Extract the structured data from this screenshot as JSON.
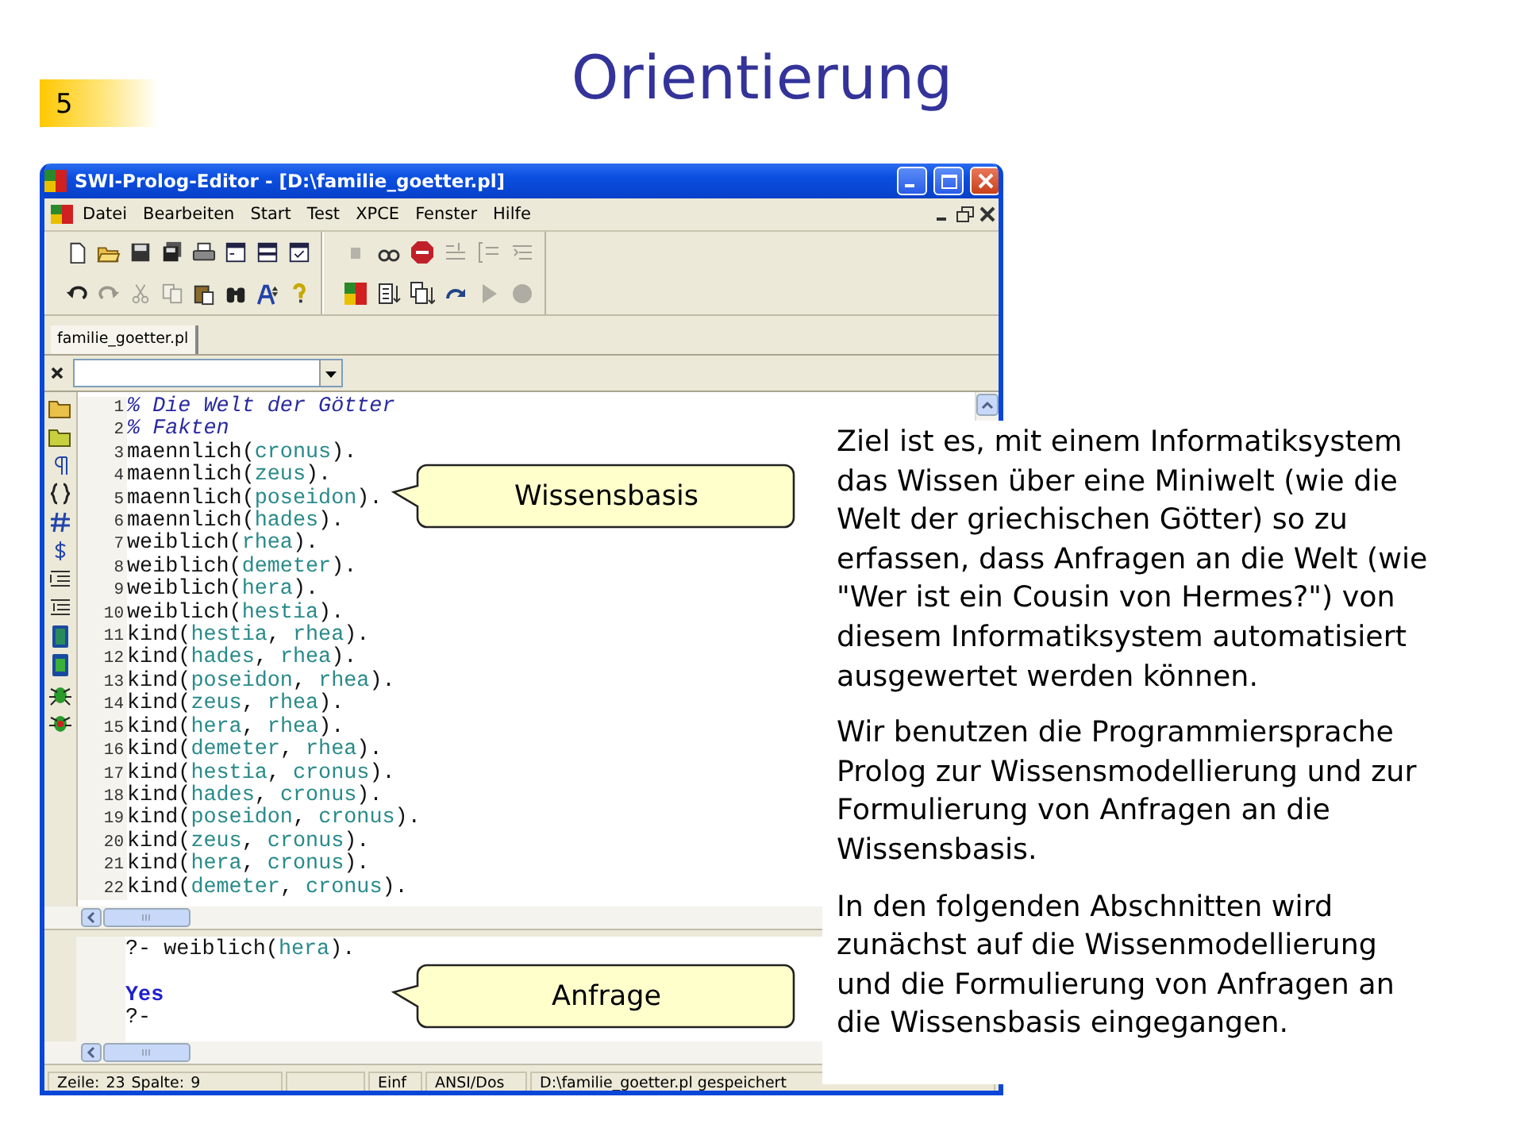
{
  "slide": {
    "number": "5",
    "title": "Orientierung"
  },
  "window": {
    "title": "SWI-Prolog-Editor - [D:\\familie_goetter.pl]",
    "menu": [
      "Datei",
      "Bearbeiten",
      "Start",
      "Test",
      "XPCE",
      "Fenster",
      "Hilfe"
    ],
    "toolbar_rows": [
      {
        "groups": [
          {
            "buttons": [
              {
                "kind": "new",
                "disabled": false
              },
              {
                "kind": "open",
                "disabled": false
              },
              {
                "kind": "save",
                "disabled": false
              },
              {
                "kind": "saveall",
                "disabled": false
              },
              {
                "kind": "print",
                "disabled": false
              },
              {
                "kind": "console",
                "disabled": false
              },
              {
                "kind": "split",
                "disabled": false
              },
              {
                "kind": "check",
                "disabled": false
              }
            ]
          },
          {
            "buttons": [
              {
                "kind": "square",
                "disabled": true
              },
              {
                "kind": "glasses",
                "disabled": false
              },
              {
                "kind": "stop",
                "disabled": false
              },
              {
                "kind": "stepin",
                "disabled": true
              },
              {
                "kind": "stepover",
                "disabled": true
              },
              {
                "kind": "stepout",
                "disabled": true
              }
            ]
          }
        ]
      },
      {
        "groups": [
          {
            "buttons": [
              {
                "kind": "undo",
                "disabled": false
              },
              {
                "kind": "redo",
                "disabled": true
              },
              {
                "kind": "cut",
                "disabled": true
              },
              {
                "kind": "copy",
                "disabled": true
              },
              {
                "kind": "paste",
                "disabled": false
              },
              {
                "kind": "find",
                "disabled": false
              },
              {
                "kind": "font",
                "disabled": false
              },
              {
                "kind": "help",
                "disabled": false
              }
            ]
          },
          {
            "buttons": [
              {
                "kind": "logo",
                "disabled": false
              },
              {
                "kind": "consult",
                "disabled": false
              },
              {
                "kind": "consultall",
                "disabled": false
              },
              {
                "kind": "rerun",
                "disabled": false
              },
              {
                "kind": "play",
                "disabled": true
              },
              {
                "kind": "record",
                "disabled": true
              }
            ]
          }
        ]
      }
    ],
    "tabs": [
      {
        "label": "familie_goetter.pl",
        "selected": true
      }
    ],
    "editor_lines": [
      {
        "number": "1",
        "tokens": [
          {
            "text": "% Die Welt der Götter",
            "kind": "comment"
          }
        ]
      },
      {
        "number": "2",
        "tokens": [
          {
            "text": "% Fakten",
            "kind": "comment"
          }
        ]
      },
      {
        "number": "3",
        "tokens": [
          {
            "text": "maennlich(",
            "kind": "plain"
          },
          {
            "text": "cronus",
            "kind": "atom"
          },
          {
            "text": ").",
            "kind": "plain"
          }
        ]
      },
      {
        "number": "4",
        "tokens": [
          {
            "text": "maennlich(",
            "kind": "plain"
          },
          {
            "text": "zeus",
            "kind": "atom"
          },
          {
            "text": ").",
            "kind": "plain"
          }
        ]
      },
      {
        "number": "5",
        "tokens": [
          {
            "text": "maennlich(",
            "kind": "plain"
          },
          {
            "text": "poseidon",
            "kind": "atom"
          },
          {
            "text": ").",
            "kind": "plain"
          }
        ]
      },
      {
        "number": "6",
        "tokens": [
          {
            "text": "maennlich(",
            "kind": "plain"
          },
          {
            "text": "hades",
            "kind": "atom"
          },
          {
            "text": ").",
            "kind": "plain"
          }
        ]
      },
      {
        "number": "7",
        "tokens": [
          {
            "text": "weiblich(",
            "kind": "plain"
          },
          {
            "text": "rhea",
            "kind": "atom"
          },
          {
            "text": ").",
            "kind": "plain"
          }
        ]
      },
      {
        "number": "8",
        "tokens": [
          {
            "text": "weiblich(",
            "kind": "plain"
          },
          {
            "text": "demeter",
            "kind": "atom"
          },
          {
            "text": ").",
            "kind": "plain"
          }
        ]
      },
      {
        "number": "9",
        "tokens": [
          {
            "text": "weiblich(",
            "kind": "plain"
          },
          {
            "text": "hera",
            "kind": "atom"
          },
          {
            "text": ").",
            "kind": "plain"
          }
        ]
      },
      {
        "number": "10",
        "tokens": [
          {
            "text": "weiblich(",
            "kind": "plain"
          },
          {
            "text": "hestia",
            "kind": "atom"
          },
          {
            "text": ").",
            "kind": "plain"
          }
        ]
      },
      {
        "number": "11",
        "tokens": [
          {
            "text": "kind(",
            "kind": "plain"
          },
          {
            "text": "hestia",
            "kind": "atom"
          },
          {
            "text": ", ",
            "kind": "plain"
          },
          {
            "text": "rhea",
            "kind": "atom"
          },
          {
            "text": ").",
            "kind": "plain"
          }
        ]
      },
      {
        "number": "12",
        "tokens": [
          {
            "text": "kind(",
            "kind": "plain"
          },
          {
            "text": "hades",
            "kind": "atom"
          },
          {
            "text": ", ",
            "kind": "plain"
          },
          {
            "text": "rhea",
            "kind": "atom"
          },
          {
            "text": ").",
            "kind": "plain"
          }
        ]
      },
      {
        "number": "13",
        "tokens": [
          {
            "text": "kind(",
            "kind": "plain"
          },
          {
            "text": "poseidon",
            "kind": "atom"
          },
          {
            "text": ", ",
            "kind": "plain"
          },
          {
            "text": "rhea",
            "kind": "atom"
          },
          {
            "text": ").",
            "kind": "plain"
          }
        ]
      },
      {
        "number": "14",
        "tokens": [
          {
            "text": "kind(",
            "kind": "plain"
          },
          {
            "text": "zeus",
            "kind": "atom"
          },
          {
            "text": ", ",
            "kind": "plain"
          },
          {
            "text": "rhea",
            "kind": "atom"
          },
          {
            "text": ").",
            "kind": "plain"
          }
        ]
      },
      {
        "number": "15",
        "tokens": [
          {
            "text": "kind(",
            "kind": "plain"
          },
          {
            "text": "hera",
            "kind": "atom"
          },
          {
            "text": ", ",
            "kind": "plain"
          },
          {
            "text": "rhea",
            "kind": "atom"
          },
          {
            "text": ").",
            "kind": "plain"
          }
        ]
      },
      {
        "number": "16",
        "tokens": [
          {
            "text": "kind(",
            "kind": "plain"
          },
          {
            "text": "demeter",
            "kind": "atom"
          },
          {
            "text": ", ",
            "kind": "plain"
          },
          {
            "text": "rhea",
            "kind": "atom"
          },
          {
            "text": ").",
            "kind": "plain"
          }
        ]
      },
      {
        "number": "17",
        "tokens": [
          {
            "text": "kind(",
            "kind": "plain"
          },
          {
            "text": "hestia",
            "kind": "atom"
          },
          {
            "text": ", ",
            "kind": "plain"
          },
          {
            "text": "cronus",
            "kind": "atom"
          },
          {
            "text": ").",
            "kind": "plain"
          }
        ]
      },
      {
        "number": "18",
        "tokens": [
          {
            "text": "kind(",
            "kind": "plain"
          },
          {
            "text": "hades",
            "kind": "atom"
          },
          {
            "text": ", ",
            "kind": "plain"
          },
          {
            "text": "cronus",
            "kind": "atom"
          },
          {
            "text": ").",
            "kind": "plain"
          }
        ]
      },
      {
        "number": "19",
        "tokens": [
          {
            "text": "kind(",
            "kind": "plain"
          },
          {
            "text": "poseidon",
            "kind": "atom"
          },
          {
            "text": ", ",
            "kind": "plain"
          },
          {
            "text": "cronus",
            "kind": "atom"
          },
          {
            "text": ").",
            "kind": "plain"
          }
        ]
      },
      {
        "number": "20",
        "tokens": [
          {
            "text": "kind(",
            "kind": "plain"
          },
          {
            "text": "zeus",
            "kind": "atom"
          },
          {
            "text": ", ",
            "kind": "plain"
          },
          {
            "text": "cronus",
            "kind": "atom"
          },
          {
            "text": ").",
            "kind": "plain"
          }
        ]
      },
      {
        "number": "21",
        "tokens": [
          {
            "text": "kind(",
            "kind": "plain"
          },
          {
            "text": "hera",
            "kind": "atom"
          },
          {
            "text": ", ",
            "kind": "plain"
          },
          {
            "text": "cronus",
            "kind": "atom"
          },
          {
            "text": ").",
            "kind": "plain"
          }
        ]
      },
      {
        "number": "22",
        "tokens": [
          {
            "text": "kind(",
            "kind": "plain"
          },
          {
            "text": "demeter",
            "kind": "atom"
          },
          {
            "text": ", ",
            "kind": "plain"
          },
          {
            "text": "cronus",
            "kind": "atom"
          },
          {
            "text": ").",
            "kind": "plain"
          }
        ]
      }
    ],
    "query_lines": [
      {
        "kind": "code",
        "tokens": [
          {
            "text": "?- weiblich(",
            "kind": "plain"
          },
          {
            "text": "hera",
            "kind": "atom"
          },
          {
            "text": ").",
            "kind": "plain"
          }
        ]
      },
      {
        "kind": "blank"
      },
      {
        "kind": "code",
        "tokens": [
          {
            "text": "Yes",
            "kind": "answer"
          }
        ]
      },
      {
        "kind": "code",
        "tokens": [
          {
            "text": "?-",
            "kind": "plain"
          }
        ]
      }
    ],
    "status_bar": {
      "line_label": "Zeile:",
      "line": "23",
      "column_label": "Spalte:",
      "column": "9",
      "mode": "Einf",
      "encoding": "ANSI/Dos",
      "message": "D:\\familie_goetter.pl gespeichert"
    }
  },
  "callouts": [
    {
      "text": "Wissensbasis"
    },
    {
      "text": "Anfrage"
    }
  ],
  "paragraphs": [
    "Ziel ist es, mit einem Informatiksystem das Wissen über eine Miniwelt (wie die Welt der griechischen Götter) so zu erfassen, dass Anfragen an die Welt (wie \"Wer ist ein Cousin von Hermes?\") von diesem Informatiksystem automatisiert ausgewertet werden können.",
    "Wir benutzen die Programmiersprache Prolog zur Wissensmodellierung und zur Formulierung von Anfragen an die Wissensbasis.",
    "In den folgenden Abschnitten wird zunächst auf die Wissenmodellierung und die Formulierung von Anfragen an die Wissensbasis eingegangen."
  ]
}
